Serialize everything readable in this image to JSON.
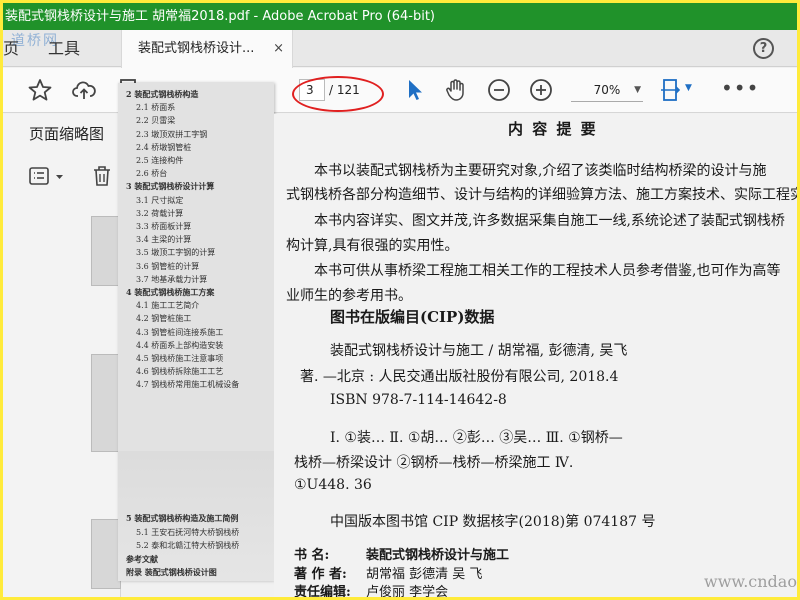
{
  "window": {
    "title": "装配式钢栈桥设计与施工  胡常福2018.pdf - Adobe Acrobat Pro (64-bit)"
  },
  "menu": {
    "home": "页",
    "tools": "工具"
  },
  "tab": {
    "label": "装配式钢栈桥设计...",
    "close": "×"
  },
  "help": "?",
  "watermark_top": "道桥网",
  "toolbar": {
    "current_page": "3",
    "total_pages": "/ 121",
    "zoom": "70%"
  },
  "left_panel": {
    "title": "页面缩略图"
  },
  "toc": [
    {
      "text": "2  装配式钢栈桥构造",
      "type": "chap"
    },
    {
      "text": "2.1  桥面系",
      "type": "sub"
    },
    {
      "text": "2.2  贝雷梁",
      "type": "sub"
    },
    {
      "text": "2.3  墩顶双拼工字钢",
      "type": "sub"
    },
    {
      "text": "2.4  桥墩钢管桩",
      "type": "sub"
    },
    {
      "text": "2.5  连接构件",
      "type": "sub"
    },
    {
      "text": "2.6  桥台",
      "type": "sub"
    },
    {
      "text": "3  装配式钢栈桥设计计算",
      "type": "chap"
    },
    {
      "text": "3.1  尺寸拟定",
      "type": "sub"
    },
    {
      "text": "3.2  荷载计算",
      "type": "sub"
    },
    {
      "text": "3.3  桥面板计算",
      "type": "sub"
    },
    {
      "text": "3.4  主梁的计算",
      "type": "sub"
    },
    {
      "text": "3.5  墩顶工字钢的计算",
      "type": "sub"
    },
    {
      "text": "3.6  钢管桩的计算",
      "type": "sub"
    },
    {
      "text": "3.7  地基承载力计算",
      "type": "sub"
    },
    {
      "text": "4  装配式钢栈桥施工方案",
      "type": "chap"
    },
    {
      "text": "4.1  施工工艺简介",
      "type": "sub"
    },
    {
      "text": "4.2  钢管桩施工",
      "type": "sub"
    },
    {
      "text": "4.3  钢管桩间连接系施工",
      "type": "sub"
    },
    {
      "text": "4.4  桥面系上部构造安装",
      "type": "sub"
    },
    {
      "text": "4.5  钢栈桥施工注意事项",
      "type": "sub"
    },
    {
      "text": "4.6  钢栈桥拆除施工工艺",
      "type": "sub"
    },
    {
      "text": "4.7  钢栈桥常用施工机械设备",
      "type": "sub"
    }
  ],
  "toc_bottom": [
    {
      "text": "5  装配式钢栈桥构造及施工简例",
      "type": "chap"
    },
    {
      "text": "5.1  王安石抚河特大桥钢栈桥",
      "type": "sub"
    },
    {
      "text": "5.2  泰和北赣江特大桥钢栈桥",
      "type": "sub"
    },
    {
      "text": "参考文献",
      "type": "chap"
    },
    {
      "text": "附录  装配式钢栈桥设计图",
      "type": "chap"
    }
  ],
  "doc": {
    "heading": "内 容 提 要",
    "p1a": "本书以装配式钢栈桥为主要研究对象,介绍了该类临时结构桥梁的设计与施",
    "p1b": "式钢栈桥各部分构造细节、设计与结构的详细验算方法、施工方案技术、实际工程实",
    "p2a": "本书内容详实、图文并茂,许多数据采集自施工一线,系统论述了装配式钢栈桥",
    "p2b": "构计算,具有很强的实用性。",
    "p3a": "本书可供从事桥梁工程施工相关工作的工程技术人员参考借鉴,也可作为高等",
    "p3b": "业师生的参考用书。",
    "cip_title": "图书在版编目(CIP)数据",
    "cip1": "装配式钢栈桥设计与施工 / 胡常福, 彭德清, 吴飞",
    "cip2": "著. —北京 : 人民交通出版社股份有限公司, 2018.4",
    "isbn": "ISBN 978-7-114-14642-8",
    "cls1": "Ⅰ. ①装…  Ⅱ. ①胡…  ②彭…  ③吴…   Ⅲ. ①钢桥—",
    "cls2": "栈桥—桥梁设计   ②钢桥—栈桥—桥梁施工   Ⅳ.",
    "cls3": "①U448. 36",
    "cip_no": "中国版本图书馆 CIP 数据核字(2018)第 074187 号",
    "book_label": "书      名:",
    "book_name": "装配式钢栈桥设计与施工",
    "author_label": "著 作 者:",
    "author_name": "胡常福   彭德清   吴  飞",
    "editor_label": "责任编辑:",
    "editor_name": "卢俊丽   李学会"
  },
  "site_watermark": "www.cndao.com"
}
